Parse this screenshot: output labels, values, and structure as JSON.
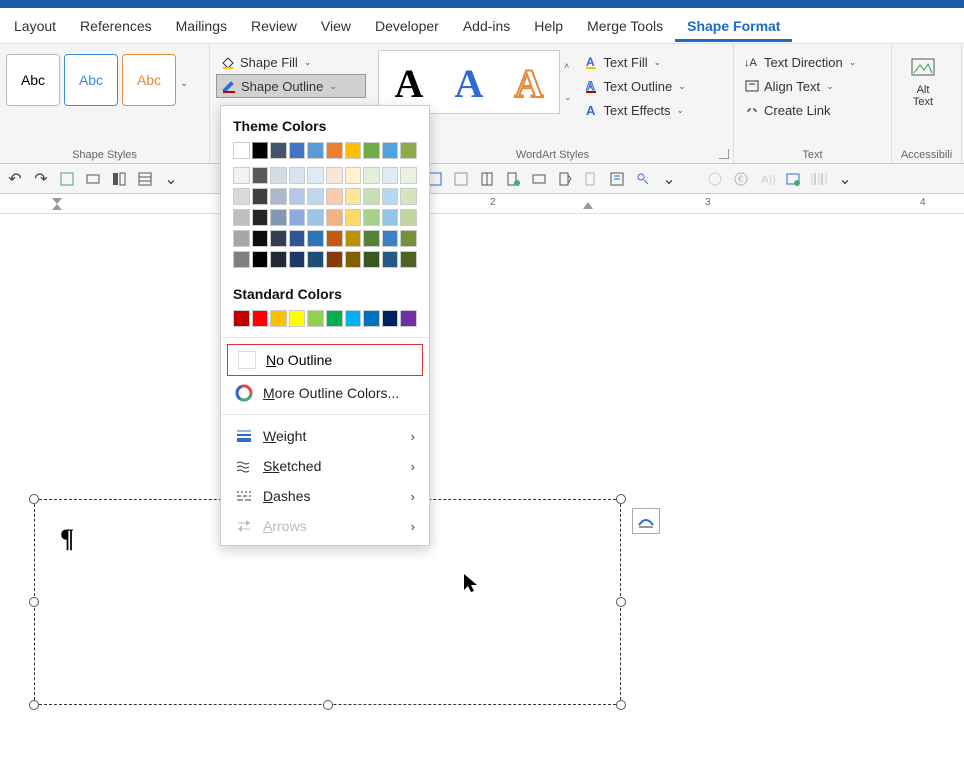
{
  "tabs": {
    "layout": "Layout",
    "references": "References",
    "mailings": "Mailings",
    "review": "Review",
    "view": "View",
    "developer": "Developer",
    "addins": "Add-ins",
    "help": "Help",
    "mergetools": "Merge Tools",
    "shapeformat": "Shape Format"
  },
  "ribbon": {
    "style_abc": "Abc",
    "shape_fill": "Shape Fill",
    "shape_outline": "Shape Outline",
    "shape_styles": "Shape Styles",
    "wordart_styles": "WordArt Styles",
    "text_fill": "Text Fill",
    "text_outline": "Text Outline",
    "text_effects": "Text Effects",
    "text_direction": "Text Direction",
    "align_text": "Align Text",
    "create_link": "Create Link",
    "text_group": "Text",
    "alt_text": "Alt Text",
    "accessibility": "Accessibili"
  },
  "dropdown": {
    "theme_colors": "Theme Colors",
    "standard_colors": "Standard Colors",
    "no_outline": "o Outline",
    "no_outline_u": "N",
    "more_colors": "ore Outline Colors...",
    "more_colors_u": "M",
    "weight": "eight",
    "weight_u": "W",
    "sketched": "etched",
    "sketched_u": "Sk",
    "dashes": "ashes",
    "dashes_u": "D",
    "arrows": "rrows",
    "arrows_u": "A",
    "theme_palette_row1": [
      "#ffffff",
      "#000000",
      "#44546a",
      "#4472c4",
      "#5b9bd5",
      "#ed7d31",
      "#ffc000",
      "#70ad47",
      "#4fa3e0",
      "#8faa4b"
    ],
    "theme_gradient_cols": [
      [
        "#f2f2f2",
        "#d9d9d9",
        "#bfbfbf",
        "#a6a6a6",
        "#808080"
      ],
      [
        "#595959",
        "#404040",
        "#262626",
        "#0d0d0d",
        "#000000"
      ],
      [
        "#d6dce5",
        "#adb9ca",
        "#8497b0",
        "#333f50",
        "#222a35"
      ],
      [
        "#d9e2f3",
        "#b4c7e7",
        "#8faadc",
        "#2f5597",
        "#1f3864"
      ],
      [
        "#deebf7",
        "#bdd7ee",
        "#9dc3e6",
        "#2e75b6",
        "#1f4e79"
      ],
      [
        "#fbe5d6",
        "#f8cbad",
        "#f4b183",
        "#c55a11",
        "#843c0c"
      ],
      [
        "#fff2cc",
        "#ffe699",
        "#ffd966",
        "#bf9000",
        "#806000"
      ],
      [
        "#e2f0d9",
        "#c5e0b4",
        "#a9d18e",
        "#548235",
        "#385723"
      ],
      [
        "#ddebf7",
        "#b7d8f0",
        "#91c5e9",
        "#3b82c4",
        "#265983"
      ],
      [
        "#eaf1df",
        "#d6e3bf",
        "#c1d59f",
        "#75913a",
        "#4f6228"
      ]
    ],
    "standard_palette": [
      "#c00000",
      "#ff0000",
      "#ffc000",
      "#ffff00",
      "#92d050",
      "#00b050",
      "#00b0f0",
      "#0070c0",
      "#002060",
      "#7030a0"
    ]
  },
  "ruler": {
    "n2": "2",
    "n3": "3",
    "n4": "4"
  },
  "paragraph_mark": "¶"
}
